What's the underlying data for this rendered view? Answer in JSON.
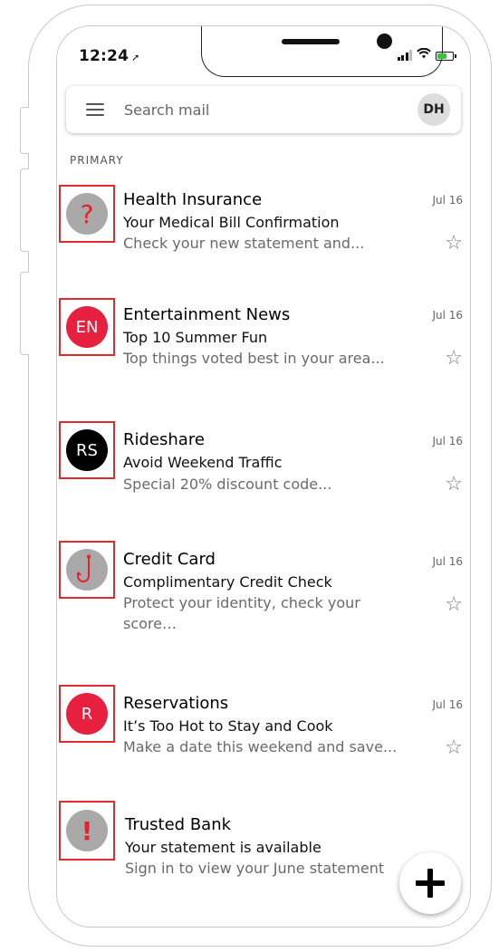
{
  "status_bar": {
    "time": "12:24",
    "location_arrow": "➚"
  },
  "search": {
    "placeholder": "Search mail",
    "avatar_initials": "DH"
  },
  "section": {
    "label": "PRIMARY"
  },
  "mails": [
    {
      "sender": "Health Insurance",
      "subject": "Your Medical Bill Confirmation",
      "snippet": "Check your new statement and...",
      "date": "Jul 16",
      "avatar": "?",
      "avatar_bg": "#a9a9a9",
      "avatar_fg": "#e8202c",
      "starred": false
    },
    {
      "sender": "Entertainment News",
      "subject": "Top 10 Summer Fun",
      "snippet": "Top things voted best in your area...",
      "date": "Jul 16",
      "avatar": "EN",
      "avatar_bg": "#e8203f",
      "avatar_fg": "#ffffff",
      "starred": false
    },
    {
      "sender": "Rideshare",
      "subject": "Avoid Weekend Traffic",
      "snippet": "Special 20% discount code...",
      "date": "Jul 16",
      "avatar": "RS",
      "avatar_bg": "#000000",
      "avatar_fg": "#ffffff",
      "starred": false
    },
    {
      "sender": "Credit Card",
      "subject": "Complimentary Credit Check",
      "snippet": "Protect your identity, check your score…",
      "date": "Jul 16",
      "avatar": "hook-icon",
      "avatar_bg": "#a9a9a9",
      "avatar_fg": "#e8202c",
      "starred": false
    },
    {
      "sender": "Reservations",
      "subject": "It’s Too Hot to Stay and Cook",
      "snippet": "Make a date this weekend and save...",
      "date": "Jul 16",
      "avatar": "R",
      "avatar_bg": "#e8203f",
      "avatar_fg": "#ffffff",
      "starred": false
    },
    {
      "sender": "Trusted Bank",
      "subject": "Your statement is available",
      "snippet": "Sign in to view your June statement",
      "date": "",
      "avatar": "!",
      "avatar_bg": "#a9a9a9",
      "avatar_fg": "#e8202c",
      "starred": false
    }
  ],
  "fab": {
    "icon": "plus-icon"
  },
  "colors": {
    "flag_border": "#e32b2b",
    "danger_red": "#e8202c",
    "avatar_gray": "#a9a9a9"
  }
}
